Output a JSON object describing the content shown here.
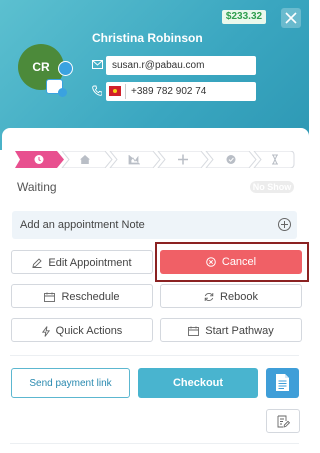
{
  "header": {
    "balance": "$233.32",
    "client": {
      "initials": "CR",
      "name": "Christina Robinson",
      "email": "susan.r@pabau.com",
      "phone": "+389 782 902 74"
    }
  },
  "icons": {
    "close": "close-icon",
    "email": "mail-icon",
    "phone": "phone-icon",
    "flag": "macedonia-flag-icon"
  },
  "stepper": {
    "steps": [
      {
        "name": "waiting",
        "icon": "clock-icon",
        "active": true
      },
      {
        "name": "arrived",
        "icon": "home-icon",
        "active": false
      },
      {
        "name": "in-consultation",
        "icon": "chart-icon",
        "active": false
      },
      {
        "name": "add",
        "icon": "plus-icon",
        "active": false
      },
      {
        "name": "complete",
        "icon": "check-circle-icon",
        "active": false
      },
      {
        "name": "timer",
        "icon": "hourglass-icon",
        "active": false
      }
    ],
    "status_label": "Waiting",
    "no_show_label": "No Show"
  },
  "note": {
    "placeholder": "Add an appointment Note"
  },
  "actions": {
    "edit": "Edit Appointment",
    "cancel": "Cancel",
    "reschedule": "Reschedule",
    "rebook": "Rebook",
    "quick_actions": "Quick Actions",
    "start_pathway": "Start Pathway"
  },
  "footer": {
    "send_payment_link": "Send payment link",
    "checkout": "Checkout"
  },
  "colors": {
    "header_start": "#5cc0d0",
    "header_end": "#2d98b4",
    "accent": "#e8508f",
    "cancel": "#f06066",
    "checkout": "#49b4cf",
    "balance_text": "#2e9e4d"
  }
}
